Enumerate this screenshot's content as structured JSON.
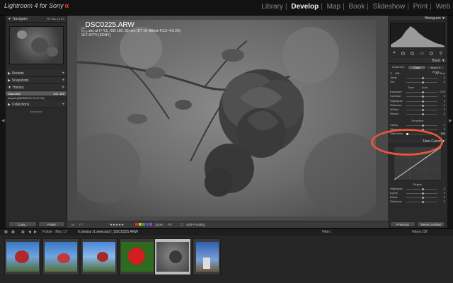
{
  "app": {
    "brand": "Lightroom 4 for Sony",
    "brand_mark": "α"
  },
  "modules": [
    "Library",
    "Develop",
    "Map",
    "Book",
    "Slideshow",
    "Print",
    "Web"
  ],
  "active_module": "Develop",
  "left_panel": {
    "navigator": "Navigator",
    "navigator_modes": "FIT  FILL  1:1  3:1",
    "presets": "Presets",
    "snapshots": "Snapshots",
    "history": "History",
    "history_items": [
      {
        "label": "Saturation",
        "from": "100",
        "to": "-100"
      },
      {
        "label": "Import (26/05/2012 12:07:16)",
        "from": "",
        "to": ""
      }
    ],
    "collections": "Collections"
  },
  "photo": {
    "filename": "_DSC0225.ARW",
    "exif": "¹⁄₂₀₀ sec at f / 4.5, ISO 160, 55 mm (DT 16–80mm F3.5–4.5 ZA)",
    "camera": "SLT-A77V (SONY)"
  },
  "toolbar": {
    "zoom_label": "Zoom",
    "zoom_value": "Fit",
    "soft_proofing": "Soft Proofing",
    "swatches": [
      "#d23030",
      "#e0c020",
      "#40a040",
      "#3060d0",
      "#a040c0"
    ]
  },
  "buttons": {
    "copy": "Copy...",
    "paste": "Paste",
    "previous": "Previous",
    "reset": "Reset (Adobe)"
  },
  "right_panel": {
    "histogram": "Histogram",
    "basic": "Basic",
    "treatment_label": "Treatment :",
    "color_tab": "Color",
    "bw_tab": "Black & White",
    "wb_label": "WB :",
    "wb_value": "As Shot",
    "temp_label": "Temp",
    "temp_value": "0",
    "tint_label": "Tint",
    "tint_value": "0",
    "tone_label": "Tone",
    "auto_label": "Auto",
    "exposure_label": "Exposure",
    "exposure_value": "0.00",
    "contrast_label": "Contrast",
    "contrast_value": "0",
    "highlights_label": "Highlights",
    "highlights_value": "0",
    "shadows_label": "Shadows",
    "shadows_value": "0",
    "whites_label": "Whites",
    "whites_value": "0",
    "blacks_label": "Blacks",
    "blacks_value": "0",
    "presence_label": "Presence",
    "clarity_label": "Clarity",
    "clarity_value": "0",
    "vibrance_label": "Vibrance",
    "vibrance_value": "0",
    "saturation_label": "Saturation",
    "saturation_value": "-100",
    "saturation_level": 0.0,
    "tone_curve": "Tone Curve",
    "region_label": "Region",
    "highlights_r_label": "Highlights",
    "highlights_r_value": "0",
    "lights_label": "Lights",
    "lights_value": "0",
    "darks_label": "Darks",
    "darks_value": "0",
    "shadows_r_label": "Shadows",
    "shadows_r_value": "0"
  },
  "filmstrip": {
    "folder": "Folder : May 17",
    "count": "6 photos /1 selected /_DSC0225.ARW",
    "filter_label": "Filter :",
    "filter_value": "Filters Off",
    "thumbs": [
      "blue-sky-roses",
      "blue-sky-roses-2",
      "blue-sky-roses-3",
      "red-rose-green",
      "bw-rose-selected",
      "blue-sky-house"
    ]
  },
  "annotation_color": "#e8563a"
}
